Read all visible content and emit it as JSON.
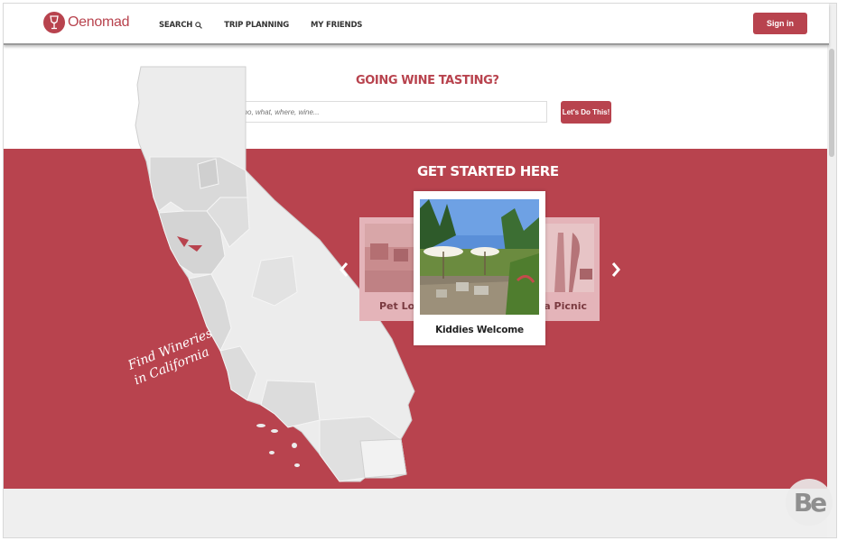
{
  "brand": {
    "name": "Oenomad",
    "color": "#b8434e"
  },
  "nav": {
    "search_label": "SEARCH",
    "trip_planning_label": "TRIP PLANNING",
    "my_friends_label": "MY FRIENDS"
  },
  "header": {
    "signin_label": "Sign in"
  },
  "hero": {
    "tagline": "GOING WINE TASTING?",
    "search_placeholder": "Who, what, where, wine...",
    "cta_label": "Let's Do This!"
  },
  "map": {
    "caption": "Find Wineries in California"
  },
  "carousel": {
    "title": "GET STARTED HERE",
    "cards": [
      {
        "label": "Pet Lovers"
      },
      {
        "label": "Kiddies Welcome"
      },
      {
        "label": "Having a Picnic"
      }
    ],
    "prev_icon": "chevron-left",
    "next_icon": "chevron-right"
  },
  "watermark": {
    "text": "Be"
  },
  "colors": {
    "accent": "#b8434e",
    "map_fill": "#ececec",
    "county_fill": "#d9d9d9"
  }
}
